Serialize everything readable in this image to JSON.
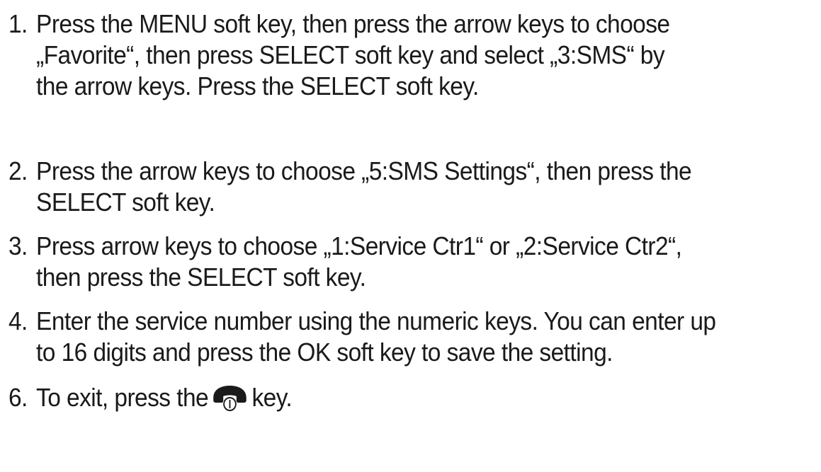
{
  "steps": [
    {
      "number": "1.",
      "lines": [
        "Press the MENU soft key, then press the arrow keys to choose",
        "„Favorite“, then press SELECT soft key and select „3:SMS“ by",
        "the arrow keys. Press the SELECT soft key."
      ]
    },
    {
      "number": "2.",
      "lines": [
        "Press the arrow keys to choose „5:SMS Settings“, then press the",
        "SELECT soft key."
      ]
    },
    {
      "number": "3.",
      "lines": [
        "Press arrow keys to choose „1:Service Ctr1“ or „2:Service Ctr2“,",
        "then press the SELECT soft key."
      ]
    },
    {
      "number": "4.",
      "lines": [
        "Enter the service number using the numeric keys. You can enter up",
        "to 16 digits and press the OK soft key to save the setting."
      ]
    },
    {
      "number": "6.",
      "before_icon": "To exit, press the",
      "icon": "hang-up-phone-icon",
      "after_icon": "key."
    }
  ]
}
